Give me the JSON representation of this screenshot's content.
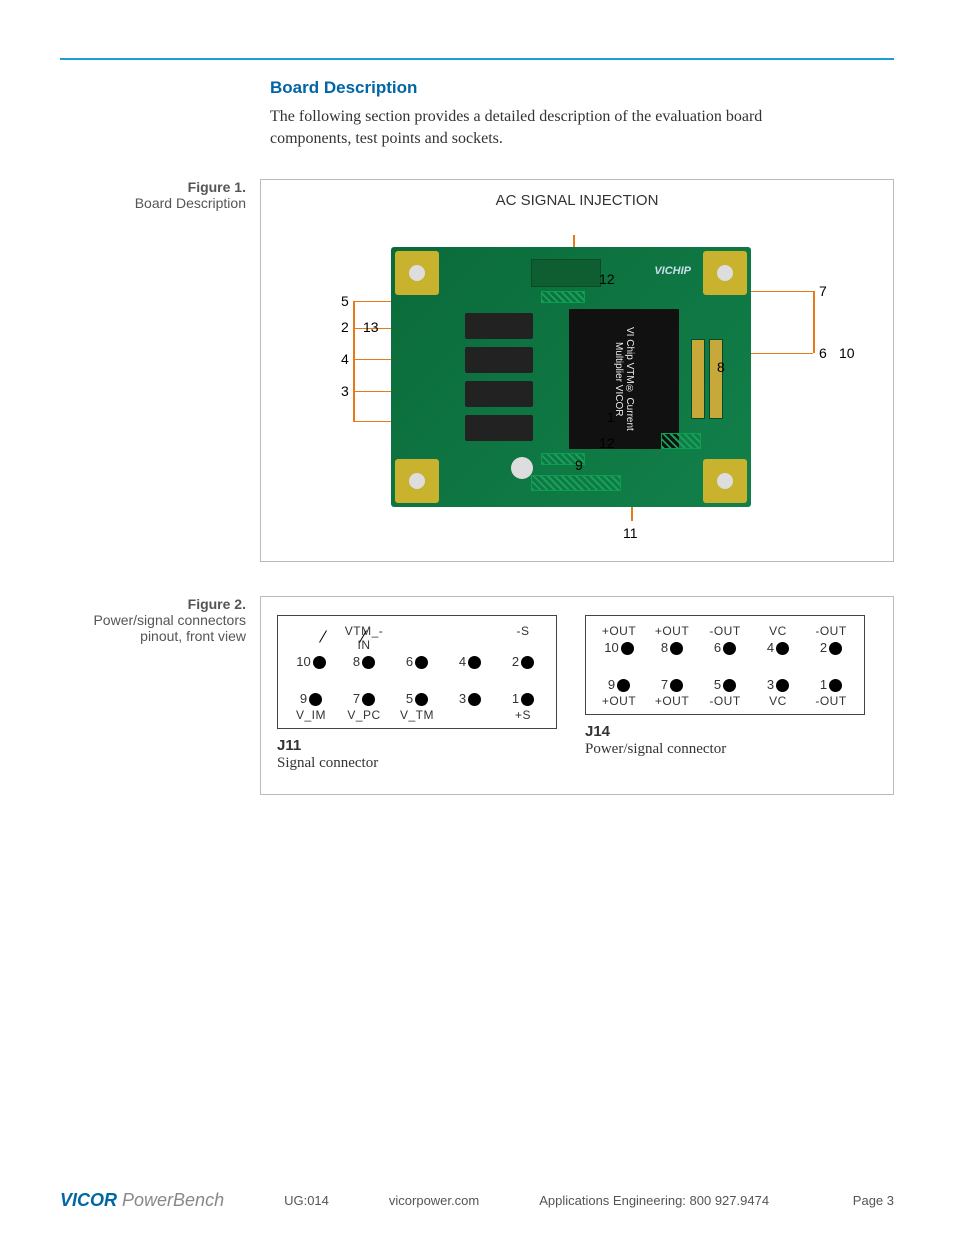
{
  "header_rule_color": "#1a9ed9",
  "section_title": "Board Description",
  "intro_text": "The following section provides a detailed description of the evaluation board components, test points and sockets.",
  "figure1": {
    "label_num": "Figure 1.",
    "label_desc": "Board Description",
    "ac_label": "AC SIGNAL INJECTION",
    "chip_text": "VI Chip VTM®\nCurrent Multiplier\nVICOR",
    "brand_text": "VICHIP",
    "callouts": [
      "1",
      "2",
      "3",
      "4",
      "5",
      "6",
      "7",
      "8",
      "9",
      "10",
      "11",
      "12",
      "13"
    ]
  },
  "figure2": {
    "label_num": "Figure 2.",
    "label_desc": "Power/signal connectors pinout, front view",
    "j11": {
      "name": "J11",
      "desc": "Signal connector",
      "top_labels": [
        "",
        "VTM_-IN",
        "",
        "",
        "-S"
      ],
      "top_row": [
        "10",
        "8",
        "6",
        "4",
        "2"
      ],
      "bot_row": [
        "9",
        "7",
        "5",
        "3",
        "1"
      ],
      "bot_labels": [
        "V_IM",
        "V_PC",
        "V_TM",
        "",
        "+S"
      ]
    },
    "j14": {
      "name": "J14",
      "desc": "Power/signal connector",
      "top_labels": [
        "+OUT",
        "+OUT",
        "-OUT",
        "VC",
        "-OUT"
      ],
      "top_row": [
        "10",
        "8",
        "6",
        "4",
        "2"
      ],
      "bot_row": [
        "9",
        "7",
        "5",
        "3",
        "1"
      ],
      "bot_labels": [
        "+OUT",
        "+OUT",
        "-OUT",
        "VC",
        "-OUT"
      ]
    }
  },
  "footer": {
    "logo_main": "VICOR",
    "logo_sub": " PowerBench",
    "doc_id": "UG:014",
    "site": "vicorpower.com",
    "contact": "Applications Engineering: 800 927.9474",
    "page": "Page 3"
  }
}
